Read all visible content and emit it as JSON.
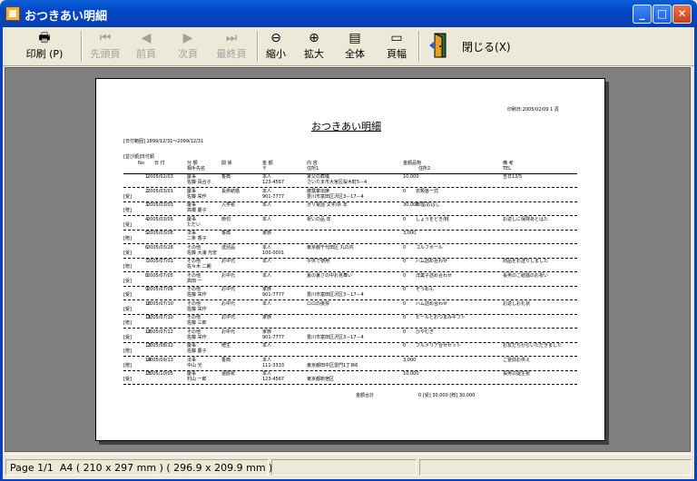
{
  "window": {
    "title": "おつきあい明細"
  },
  "toolbar": {
    "print": {
      "label": "印刷",
      "accel": "(P)"
    },
    "first": "先頭頁",
    "prev": "前頁",
    "next": "次頁",
    "last": "最終頁",
    "zoom_out": "縮小",
    "zoom_in": "拡大",
    "whole": "全体",
    "width": "頁幅",
    "close": {
      "label": "閉じる",
      "accel": "(X)"
    }
  },
  "status": {
    "page": "Page  1/1",
    "paper": "A4 ( 210 x 297 mm ) ( 296.9 x 209.9 mm )"
  },
  "report": {
    "print_date": "印刷日:2005/02/09  1 頁",
    "title": "おつきあい明細",
    "range": "[日付範囲] 1899/12/31～2099/12/31",
    "sort": "[並び順]日付順",
    "headers": {
      "no": "No",
      "date": "日 付",
      "category": "分 類",
      "category_sub": "相手先名",
      "relation": "関 係",
      "amount_label": "金 額",
      "amount_sub": "〒",
      "content": "内 容",
      "content_sub": "住所1",
      "money": "金額品物",
      "money_sub": "住所2",
      "remarks": "備 考",
      "remarks_sub": "TEL"
    },
    "rows": [
      {
        "no": "1",
        "tag": "",
        "date": "2005/02/03",
        "type": "慶事",
        "name": "佐藤 百合子",
        "rel": "香典",
        "kind": "本人",
        "zip": "123-4567",
        "content": "家父の葬儀",
        "addr": "さいたま市大宮区桜木町5－4",
        "amount": "10,000",
        "item": "",
        "note": "告日13/5"
      },
      {
        "no": "2",
        "tag": "[受]",
        "date": "2005/03/01",
        "type": "慶事",
        "name": "佐藤 栄作",
        "rel": "長男結婚",
        "kind": "本人",
        "zip": "901-7777",
        "content": "披露宴出席",
        "addr": "豊川市富田区沢区3－17－4",
        "amount": "0",
        "item": "衣類各一式",
        "note": ""
      },
      {
        "no": "3",
        "tag": "[贈]",
        "date": "2005/03/03",
        "type": "慶事",
        "name": "高橋 慶子",
        "rel": "入学祝",
        "kind": "本人",
        "zip": "",
        "content": "ガリ電話 文字/外 年",
        "addr": "",
        "amount": "30,000",
        "item": "料理/おはし",
        "note": ""
      },
      {
        "no": "4",
        "tag": "[受]",
        "date": "2005/03/05",
        "type": "慶事",
        "name": "ただい",
        "rel": "節句",
        "kind": "本人",
        "zip": "",
        "content": "祝いの品 年",
        "addr": "",
        "amount": "0",
        "item": "しょうをどき/桃",
        "note": "お返しに保険あとはた"
      },
      {
        "no": "5",
        "tag": "[贈]",
        "date": "2005/03/08",
        "type": "法事",
        "name": "二条 香子",
        "rel": "香典",
        "kind": "家族",
        "zip": "",
        "content": "",
        "addr": "",
        "amount": "3,000",
        "item": "",
        "note": ""
      },
      {
        "no": "6",
        "tag": "[受]",
        "date": "2005/03/28",
        "type": "その他",
        "name": "佐藤 大浦 光宏",
        "rel": "送別品",
        "kind": "本人",
        "zip": "100-0001",
        "content": "東京都千代田区 丸の内",
        "addr": "",
        "amount": "0",
        "item": "ゴルフボール",
        "note": ""
      },
      {
        "no": "7",
        "tag": "[贈]",
        "date": "2005/07/01",
        "type": "その他",
        "name": "佐々木 二朗",
        "rel": "お中元",
        "kind": "本人",
        "zip": "",
        "content": "子供で使用",
        "addr": "",
        "amount": "0",
        "item": "ハム詰め合わせ",
        "note": "商品をお送りしました"
      },
      {
        "no": "8",
        "tag": "[受]",
        "date": "2005/07/05",
        "type": "その他",
        "name": "高田 一",
        "rel": "お中元",
        "kind": "本人",
        "zip": "",
        "content": "夏の暑さの中お見舞い",
        "addr": "",
        "amount": "0",
        "item": "洋菓子詰め合わせ",
        "note": "長男のご結婚のお祝い"
      },
      {
        "no": "9",
        "tag": "[受]",
        "date": "2005/07/08",
        "type": "その他",
        "name": "佐藤 栄作",
        "rel": "お中元",
        "kind": "家族",
        "zip": "901-7777",
        "content": "",
        "addr": "豊川市富田区沢区3－17－4",
        "amount": "0",
        "item": "そうめん",
        "note": ""
      },
      {
        "no": "10",
        "tag": "[受]",
        "date": "2005/07/10",
        "type": "その他",
        "name": "佐藤 栄作",
        "rel": "お中元",
        "kind": "本人",
        "zip": "",
        "content": "ロロの挨拶",
        "addr": "",
        "amount": "0",
        "item": "ハム詰め合わせ",
        "note": "お返しお礼状"
      },
      {
        "no": "11",
        "tag": "[贈]",
        "date": "2005/07/10",
        "type": "その他",
        "name": "佐藤 三郎",
        "rel": "お中元",
        "kind": "家族",
        "zip": "",
        "content": "",
        "addr": "",
        "amount": "0",
        "item": "ビールとおつまみギフト",
        "note": ""
      },
      {
        "no": "12",
        "tag": "[受]",
        "date": "2005/07/12",
        "type": "その他",
        "name": "佐藤 栄作",
        "rel": "お中元",
        "kind": "家族",
        "zip": "901-7777",
        "content": "",
        "addr": "豊川市富田区沢区3－17－4",
        "amount": "0",
        "item": "ひやむぎ",
        "note": ""
      },
      {
        "no": "13",
        "tag": "[贈]",
        "date": "2005/08/12",
        "type": "慶事",
        "name": "佐藤 慶子",
        "rel": "贈生",
        "kind": "本人",
        "zip": "",
        "content": "",
        "addr": "",
        "amount": "0",
        "item": "ブルメリア合せセット",
        "note": "お友だちからいただきました"
      },
      {
        "no": "14",
        "tag": "[贈]",
        "date": "2005/09/13",
        "type": "法事",
        "name": "中山 光",
        "rel": "香典",
        "kind": "本人",
        "zip": "111-3333",
        "content": "",
        "addr": "東京都田中区雷門1丁目6",
        "amount": "3,000",
        "item": "",
        "note": "ご霊前お供え"
      },
      {
        "no": "15",
        "tag": "[受]",
        "date": "2005/10/05",
        "type": "慶事",
        "name": "村山 一郎",
        "rel": "還暦祝",
        "kind": "本人",
        "zip": "123-4567",
        "content": "",
        "addr": "東京都新宿区",
        "amount": "10,000",
        "item": "",
        "note": "長男の誕生祝"
      }
    ],
    "total_label": "金額合計",
    "total_value": "0  [受] 30,000  [贈] 30,000"
  }
}
